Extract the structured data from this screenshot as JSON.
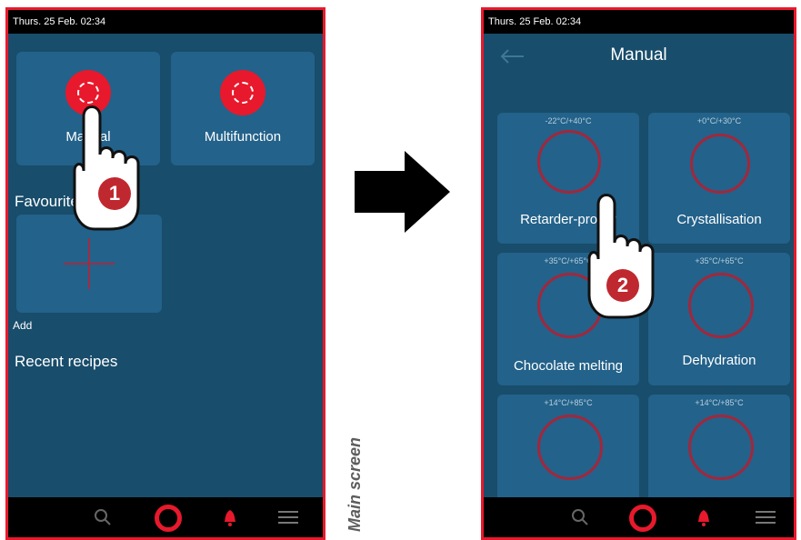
{
  "screen1": {
    "status_time": "Thurs. 25 Feb. 02:34",
    "tiles": [
      {
        "label": "Manual",
        "icon": "manual-mode-icon"
      },
      {
        "label": "Multifunction",
        "icon": "multifunction-mode-icon"
      }
    ],
    "favourites_heading": "Favourites",
    "add_label": "Add",
    "add_icon": "plus-icon",
    "recent_heading": "Recent recipes",
    "nav_icons": [
      "search-icon",
      "home-ring-icon",
      "bell-icon",
      "menu-icon"
    ],
    "step_badge": "1"
  },
  "screen2": {
    "status_time": "Thurs. 25 Feb. 02:34",
    "title": "Manual",
    "back_icon": "back-arrow-icon",
    "tiles": [
      {
        "label": "Retarder-prover",
        "temp": "-22°C/+40°C",
        "icon": "bread-icon"
      },
      {
        "label": "Crystallisation",
        "temp": "+0°C/+30°C",
        "icon": "sugar-cubes-icon"
      },
      {
        "label": "Chocolate melting",
        "temp": "+35°C/+65°C",
        "icon": "chocolate-icon"
      },
      {
        "label": "Dehydration",
        "temp": "+35°C/+65°C",
        "icon": "dehydration-icon"
      },
      {
        "label": "",
        "temp": "+14°C/+85°C",
        "icon": "cup-icon"
      },
      {
        "label": "",
        "temp": "+14°C/+85°C",
        "icon": "sauce-icon"
      }
    ],
    "nav_icons": [
      "search-icon",
      "home-ring-icon",
      "bell-icon",
      "menu-icon"
    ],
    "step_badge": "2"
  },
  "side_label": "Main screen",
  "arrow_icon": "right-arrow-icon",
  "colors": {
    "accent": "#e8192c",
    "background": "#184d6b",
    "tile": "#23628a"
  }
}
